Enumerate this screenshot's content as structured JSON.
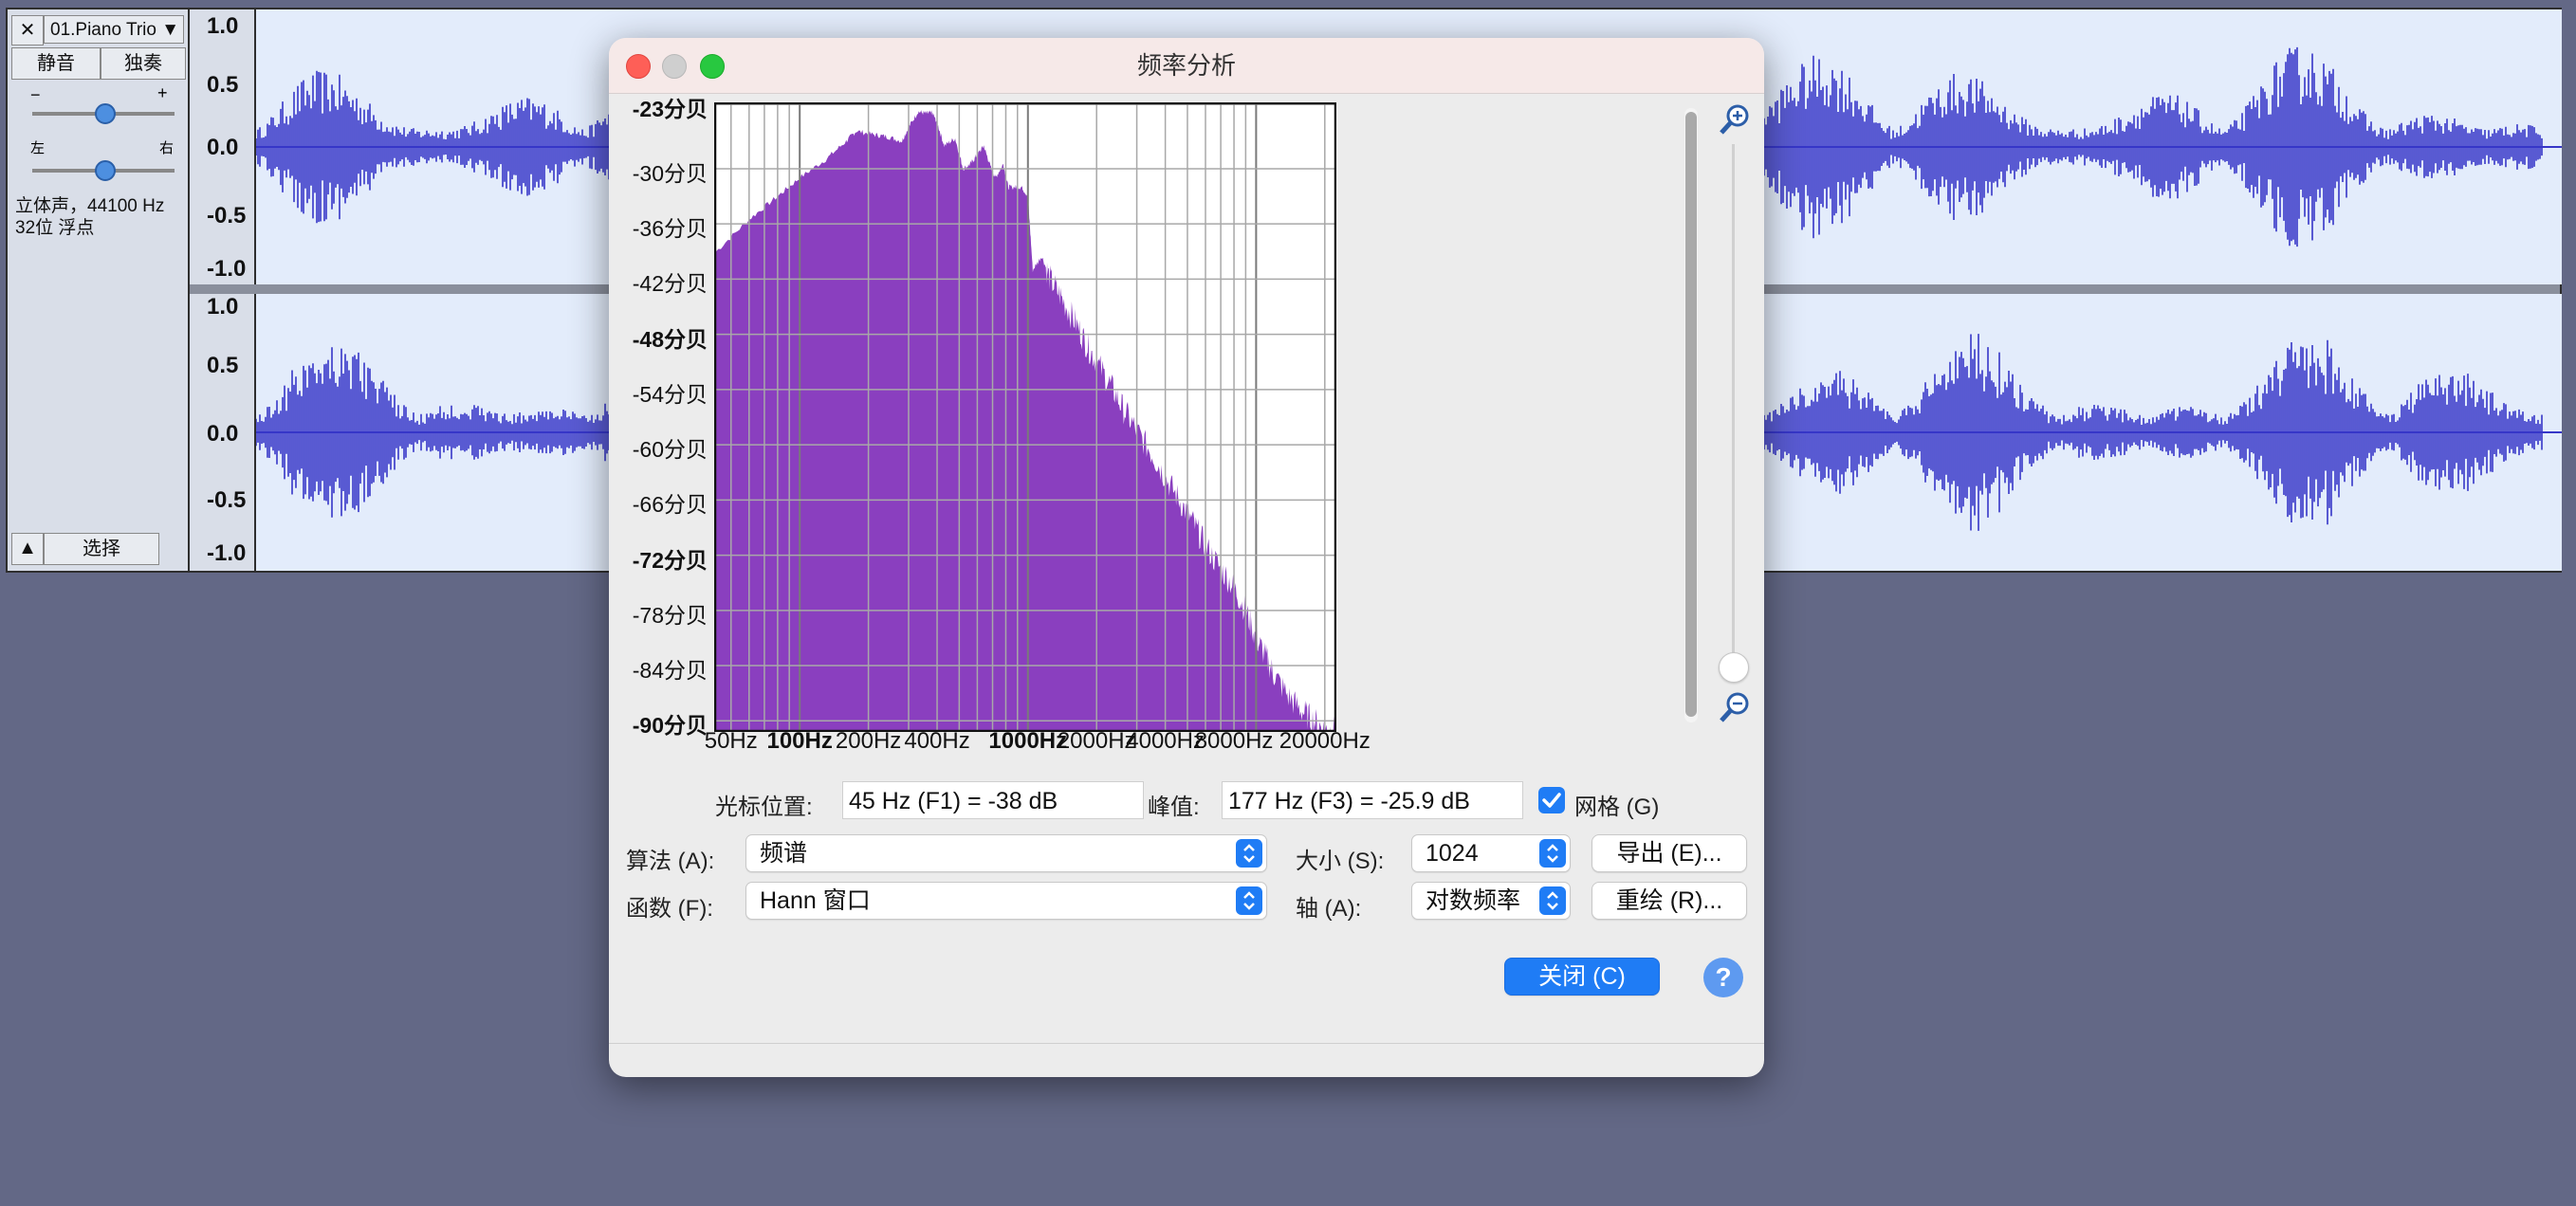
{
  "track": {
    "name": "01.Piano Trio",
    "close_glyph": "✕",
    "mute_label": "静音",
    "solo_label": "独奏",
    "gain_minus": "−",
    "gain_plus": "+",
    "pan_left": "左",
    "pan_right": "右",
    "info_line1": "立体声，44100 Hz",
    "info_line2": "32位 浮点",
    "select_label": "选择",
    "ruler_ticks": [
      "1.0",
      "0.5",
      "0.0",
      "-0.5",
      "-1.0"
    ]
  },
  "dialog": {
    "title": "频率分析",
    "cursor_label": "光标位置:",
    "cursor_value": "45 Hz (F1) = -38 dB",
    "peak_label": "峰值:",
    "peak_value": "177 Hz (F3) = -25.9 dB",
    "grid_label": "网格 (G)",
    "grid_checked": true,
    "algorithm_label": "算法 (A):",
    "algorithm_value": "频谱",
    "size_label": "大小 (S):",
    "size_value": "1024",
    "export_label": "导出 (E)...",
    "function_label": "函数 (F):",
    "function_value": "Hann 窗口",
    "axis_label": "轴 (A):",
    "axis_value": "对数频率",
    "replot_label": "重绘 (R)...",
    "close_label": "关闭 (C)",
    "help_label": "?"
  },
  "colors": {
    "spectrum_fill": "#8a3fbf",
    "waveform": "#3636c8",
    "accent": "#1f7cf5",
    "desktop": "#636886"
  },
  "chart_data": {
    "type": "area",
    "y_tick_labels": [
      "-23分贝",
      "-30分贝",
      "-36分贝",
      "-42分贝",
      "-48分贝",
      "-54分贝",
      "-60分贝",
      "-66分贝",
      "-72分贝",
      "-78分贝",
      "-84分贝",
      "-90分贝"
    ],
    "x_tick_labels": [
      "50Hz",
      "100Hz",
      "200Hz",
      "400Hz",
      "1000Hz",
      "2000Hz",
      "4000Hz",
      "8000Hz",
      "20000Hz"
    ],
    "xscale": "log",
    "xlim": [
      43,
      22050
    ],
    "ylim": [
      -91,
      -23
    ],
    "grid": true,
    "x": [
      43,
      60,
      80,
      100,
      130,
      160,
      177,
      210,
      240,
      280,
      300,
      330,
      360,
      380,
      400,
      430,
      480,
      520,
      560,
      600,
      640,
      680,
      720,
      780,
      820,
      880,
      940,
      1000,
      1050,
      1150,
      1250,
      1400,
      1600,
      1800,
      2000,
      2300,
      2600,
      3000,
      3500,
      4000,
      4600,
      5300,
      6000,
      7000,
      8000,
      9000,
      10000,
      11000,
      12000,
      14000,
      16000,
      18000,
      20000,
      22050
    ],
    "y": [
      -39,
      -35.5,
      -33,
      -31,
      -29,
      -27,
      -25.9,
      -26.3,
      -26.5,
      -27,
      -25.5,
      -23.8,
      -24,
      -23.9,
      -25,
      -27.5,
      -26.7,
      -30,
      -29.5,
      -28.5,
      -27.5,
      -29.5,
      -31,
      -29.5,
      -32,
      -32,
      -32,
      -33,
      -41,
      -39.5,
      -42,
      -44,
      -46.5,
      -49,
      -51,
      -53.5,
      -56,
      -58.5,
      -61,
      -63.5,
      -66,
      -68.5,
      -71,
      -73.5,
      -75.5,
      -78,
      -81,
      -83,
      -85,
      -87.5,
      -89,
      -90,
      -91,
      -91
    ]
  }
}
